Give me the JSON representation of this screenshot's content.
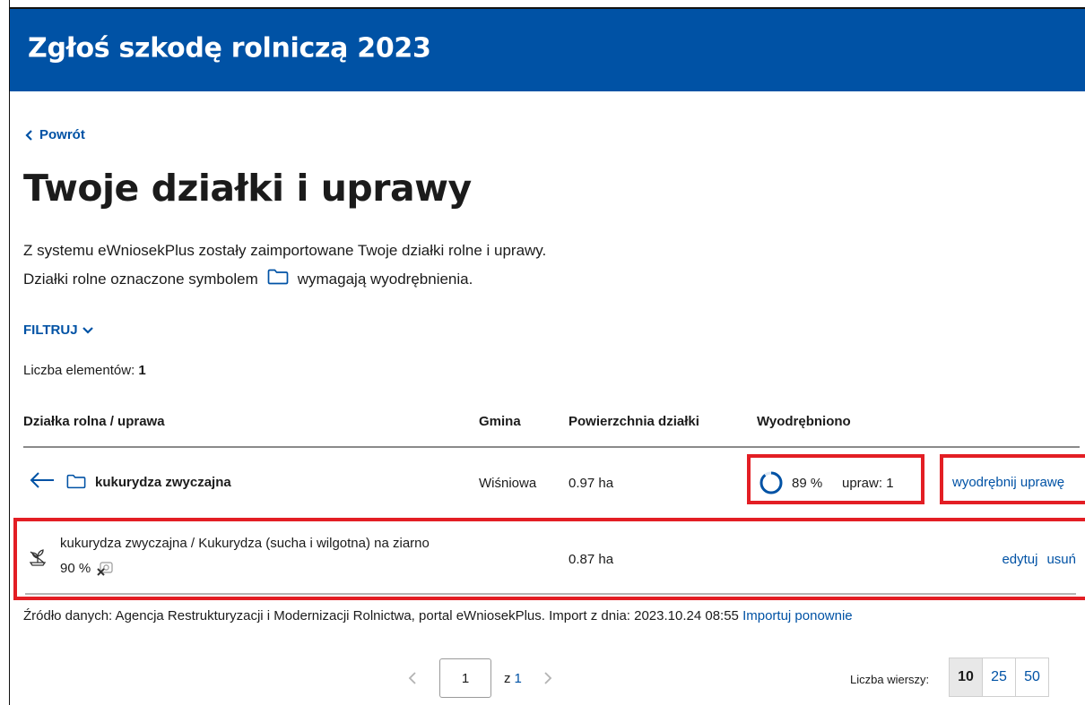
{
  "header": {
    "title": "Zgłoś szkodę rolniczą 2023",
    "bg_color": "#0052a5"
  },
  "nav": {
    "back_label": "Powrót"
  },
  "page": {
    "title": "Twoje działki i uprawy",
    "intro_line1": "Z systemu eWniosekPlus zostały zaimportowane Twoje działki rolne i uprawy.",
    "intro_line2_before": "Działki rolne oznaczone symbolem",
    "intro_line2_after": "wymagają wyodrębnienia.",
    "filter_label": "FILTRUJ",
    "count_label": "Liczba elementów:",
    "count_value": "1"
  },
  "table": {
    "columns": [
      "Działka rolna / uprawa",
      "Gmina",
      "Powierzchnia działki",
      "Wyodrębniono"
    ],
    "parcel": {
      "name": "kukurydza zwyczajna",
      "gmina": "Wiśniowa",
      "area": "0.97 ha",
      "extracted_percent": "89 %",
      "extracted_progress": 0.89,
      "crops_count": "upraw: 1",
      "action": "wyodrębnij uprawę",
      "icons": [
        "arrow-left-icon",
        "folder-icon"
      ]
    },
    "crop": {
      "name": "kukurydza zwyczajna / Kukurydza (sucha i wilgotna) na ziarno",
      "percent": "90 %",
      "area": "0.87 ha",
      "edit_label": "edytuj",
      "delete_label": "usuń",
      "icons": [
        "crop-sprout-icon",
        "no-photo-icon"
      ]
    },
    "highlight_color": "#e31e24"
  },
  "source": {
    "text": "Źródło danych: Agencja Restrukturyzacji i Modernizacji Rolnictwa, portal eWniosekPlus. Import z dnia: 2023.10.24 08:55",
    "reimport_label": "Importuj ponownie"
  },
  "pagination": {
    "current_page": "1",
    "of_label": "z",
    "total_pages": "1",
    "rows_label": "Liczba wierszy:",
    "rows_options": [
      "10",
      "25",
      "50"
    ],
    "rows_selected": "10"
  },
  "colors": {
    "link": "#0052a5",
    "text": "#1b1b1b"
  }
}
